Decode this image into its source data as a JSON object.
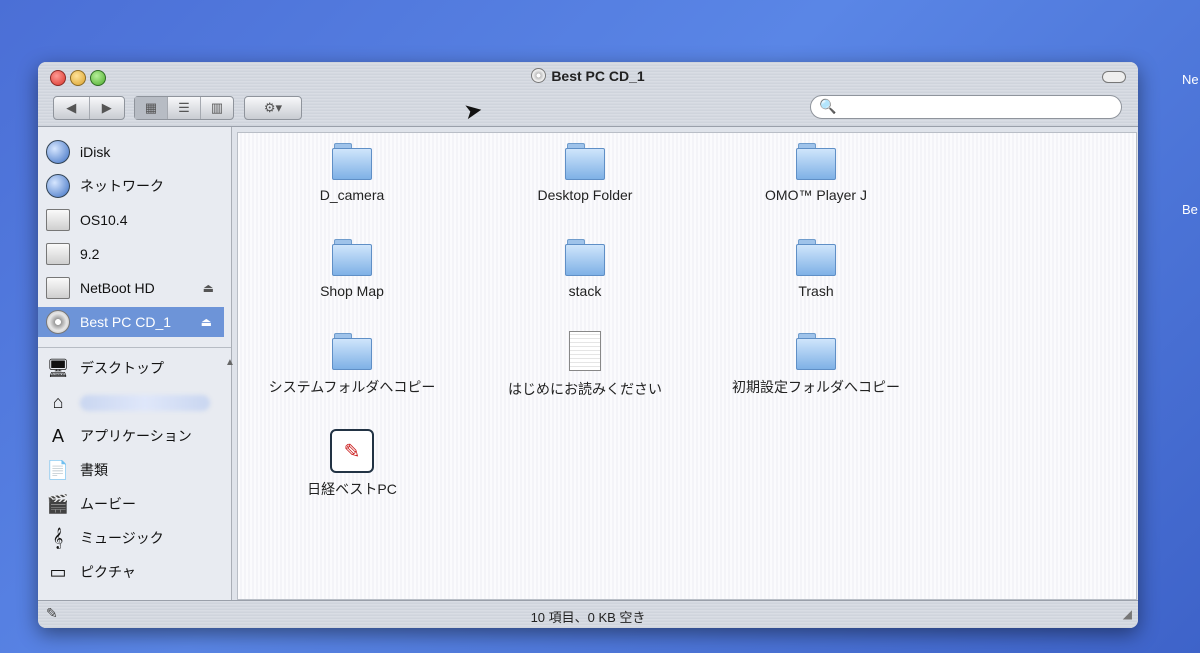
{
  "window": {
    "title": "Best PC CD_1"
  },
  "desktop": {
    "labels": [
      "Ne",
      "Be"
    ]
  },
  "toolbar": {
    "back_label": "◀",
    "forward_label": "▶",
    "view_icon": "▦",
    "view_list": "☰",
    "view_column": "▥",
    "action_label": "⚙▾",
    "search_placeholder": ""
  },
  "sidebar": {
    "devices": [
      {
        "label": "iDisk",
        "icon": "globe"
      },
      {
        "label": "ネットワーク",
        "icon": "globe"
      },
      {
        "label": "OS10.4",
        "icon": "disk"
      },
      {
        "label": "9.2",
        "icon": "disk"
      },
      {
        "label": "NetBoot HD",
        "icon": "disk",
        "eject": "⏏"
      },
      {
        "label": "Best PC CD_1",
        "icon": "cd",
        "eject": "⏏",
        "selected": true
      }
    ],
    "places": [
      {
        "label": "デスクトップ",
        "icon": "🖥"
      },
      {
        "label": "",
        "icon": "⌂"
      },
      {
        "label": "アプリケーション",
        "icon": "A"
      },
      {
        "label": "書類",
        "icon": "📄"
      },
      {
        "label": "ムービー",
        "icon": "🎬"
      },
      {
        "label": "ミュージック",
        "icon": "𝄞"
      },
      {
        "label": "ピクチャ",
        "icon": "▭"
      }
    ]
  },
  "content": {
    "items": [
      {
        "label": "D_camera",
        "type": "folder"
      },
      {
        "label": "Desktop Folder",
        "type": "folder"
      },
      {
        "label": "OMO™ Player J",
        "type": "folder"
      },
      {
        "label": "Shop Map",
        "type": "folder"
      },
      {
        "label": "stack",
        "type": "folder"
      },
      {
        "label": "Trash",
        "type": "folder"
      },
      {
        "label": "システムフォルダへコピー",
        "type": "folder"
      },
      {
        "label": "はじめにお読みください",
        "type": "document"
      },
      {
        "label": "初期設定フォルダへコピー",
        "type": "folder"
      },
      {
        "label": "日経ベストPC",
        "type": "app"
      }
    ]
  },
  "status": {
    "text": "10 項目、0 KB 空き"
  }
}
